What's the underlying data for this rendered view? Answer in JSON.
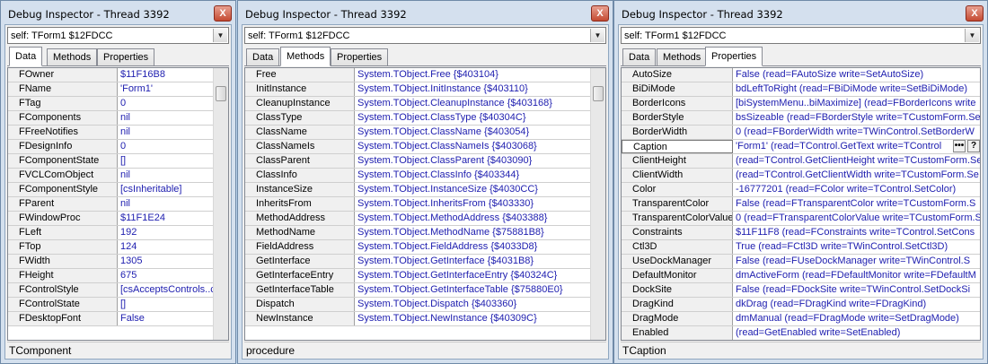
{
  "colors": {
    "value_text": "#2020b0",
    "frame": "#d4e0ee"
  },
  "windows": [
    {
      "title": "Debug Inspector - Thread 3392",
      "close_glyph": "X",
      "combo_value": "self: TForm1 $12FDCC",
      "combo_arrow": "▼",
      "tabs": [
        "Data",
        "Methods",
        "Properties"
      ],
      "active_tab": 0,
      "status": "TComponent",
      "rows": [
        {
          "name": "FOwner",
          "value": "$11F16B8"
        },
        {
          "name": "FName",
          "value": "'Form1'"
        },
        {
          "name": "FTag",
          "value": "0"
        },
        {
          "name": "FComponents",
          "value": "nil"
        },
        {
          "name": "FFreeNotifies",
          "value": "nil"
        },
        {
          "name": "FDesignInfo",
          "value": "0"
        },
        {
          "name": "FComponentState",
          "value": "[]"
        },
        {
          "name": "FVCLComObject",
          "value": "nil"
        },
        {
          "name": "FComponentStyle",
          "value": "[csInheritable]"
        },
        {
          "name": "FParent",
          "value": "nil"
        },
        {
          "name": "FWindowProc",
          "value": "$11F1E24"
        },
        {
          "name": "FLeft",
          "value": "192"
        },
        {
          "name": "FTop",
          "value": "124"
        },
        {
          "name": "FWidth",
          "value": "1305"
        },
        {
          "name": "FHeight",
          "value": "675"
        },
        {
          "name": "FControlStyle",
          "value": "[csAcceptsControls..c"
        },
        {
          "name": "FControlState",
          "value": "[]"
        },
        {
          "name": "FDesktopFont",
          "value": "False"
        }
      ]
    },
    {
      "title": "Debug Inspector - Thread 3392",
      "close_glyph": "X",
      "combo_value": "self: TForm1 $12FDCC",
      "combo_arrow": "▼",
      "tabs": [
        "Data",
        "Methods",
        "Properties"
      ],
      "active_tab": 1,
      "status": "procedure",
      "rows": [
        {
          "name": "Free",
          "value": "System.TObject.Free {$403104}"
        },
        {
          "name": "InitInstance",
          "value": "System.TObject.InitInstance {$403110}"
        },
        {
          "name": "CleanupInstance",
          "value": "System.TObject.CleanupInstance {$403168}"
        },
        {
          "name": "ClassType",
          "value": "System.TObject.ClassType {$40304C}"
        },
        {
          "name": "ClassName",
          "value": "System.TObject.ClassName {$403054}"
        },
        {
          "name": "ClassNameIs",
          "value": "System.TObject.ClassNameIs {$403068}"
        },
        {
          "name": "ClassParent",
          "value": "System.TObject.ClassParent {$403090}"
        },
        {
          "name": "ClassInfo",
          "value": "System.TObject.ClassInfo {$403344}"
        },
        {
          "name": "InstanceSize",
          "value": "System.TObject.InstanceSize {$4030CC}"
        },
        {
          "name": "InheritsFrom",
          "value": "System.TObject.InheritsFrom {$403330}"
        },
        {
          "name": "MethodAddress",
          "value": "System.TObject.MethodAddress {$403388}"
        },
        {
          "name": "MethodName",
          "value": "System.TObject.MethodName {$75881B8}"
        },
        {
          "name": "FieldAddress",
          "value": "System.TObject.FieldAddress {$4033D8}"
        },
        {
          "name": "GetInterface",
          "value": "System.TObject.GetInterface {$4031B8}"
        },
        {
          "name": "GetInterfaceEntry",
          "value": "System.TObject.GetInterfaceEntry {$40324C}"
        },
        {
          "name": "GetInterfaceTable",
          "value": "System.TObject.GetInterfaceTable {$75880E0}"
        },
        {
          "name": "Dispatch",
          "value": "System.TObject.Dispatch {$403360}"
        },
        {
          "name": "NewInstance",
          "value": "System.TObject.NewInstance {$40309C}"
        }
      ]
    },
    {
      "title": "Debug Inspector - Thread 3392",
      "close_glyph": "X",
      "combo_value": "self: TForm1 $12FDCC",
      "combo_arrow": "▼",
      "tabs": [
        "Data",
        "Methods",
        "Properties"
      ],
      "active_tab": 2,
      "status": "TCaption",
      "edit_buttons": [
        "•••",
        "?"
      ],
      "rows": [
        {
          "name": "AutoSize",
          "value": "False  (read=FAutoSize write=SetAutoSize)"
        },
        {
          "name": "BiDiMode",
          "value": "bdLeftToRight  (read=FBiDiMode write=SetBiDiMode)"
        },
        {
          "name": "BorderIcons",
          "value": "[biSystemMenu..biMaximize]  (read=FBorderIcons write"
        },
        {
          "name": "BorderStyle",
          "value": "bsSizeable  (read=FBorderStyle write=TCustomForm.Se"
        },
        {
          "name": "BorderWidth",
          "value": "0  (read=FBorderWidth write=TWinControl.SetBorderW"
        },
        {
          "name": "Caption",
          "value": "'Form1'  (read=TControl.GetText write=TControl"
        },
        {
          "name": "ClientHeight",
          "value": "(read=TControl.GetClientHeight write=TCustomForm.Se"
        },
        {
          "name": "ClientWidth",
          "value": "(read=TControl.GetClientWidth write=TCustomForm.Se"
        },
        {
          "name": "Color",
          "value": "-16777201  (read=FColor write=TControl.SetColor)"
        },
        {
          "name": "TransparentColor",
          "value": "False  (read=FTransparentColor write=TCustomForm.S"
        },
        {
          "name": "TransparentColorValue",
          "value": "0  (read=FTransparentColorValue write=TCustomForm.Se"
        },
        {
          "name": "Constraints",
          "value": "$11F11F8  (read=FConstraints write=TControl.SetCons"
        },
        {
          "name": "Ctl3D",
          "value": "True  (read=FCtl3D write=TWinControl.SetCtl3D)"
        },
        {
          "name": "UseDockManager",
          "value": "False  (read=FUseDockManager write=TWinControl.S"
        },
        {
          "name": "DefaultMonitor",
          "value": "dmActiveForm  (read=FDefaultMonitor write=FDefaultM"
        },
        {
          "name": "DockSite",
          "value": "False  (read=FDockSite write=TWinControl.SetDockSi"
        },
        {
          "name": "DragKind",
          "value": "dkDrag  (read=FDragKind write=FDragKind)"
        },
        {
          "name": "DragMode",
          "value": "dmManual  (read=FDragMode write=SetDragMode)"
        },
        {
          "name": "Enabled",
          "value": "(read=GetEnabled write=SetEnabled)"
        }
      ]
    }
  ]
}
